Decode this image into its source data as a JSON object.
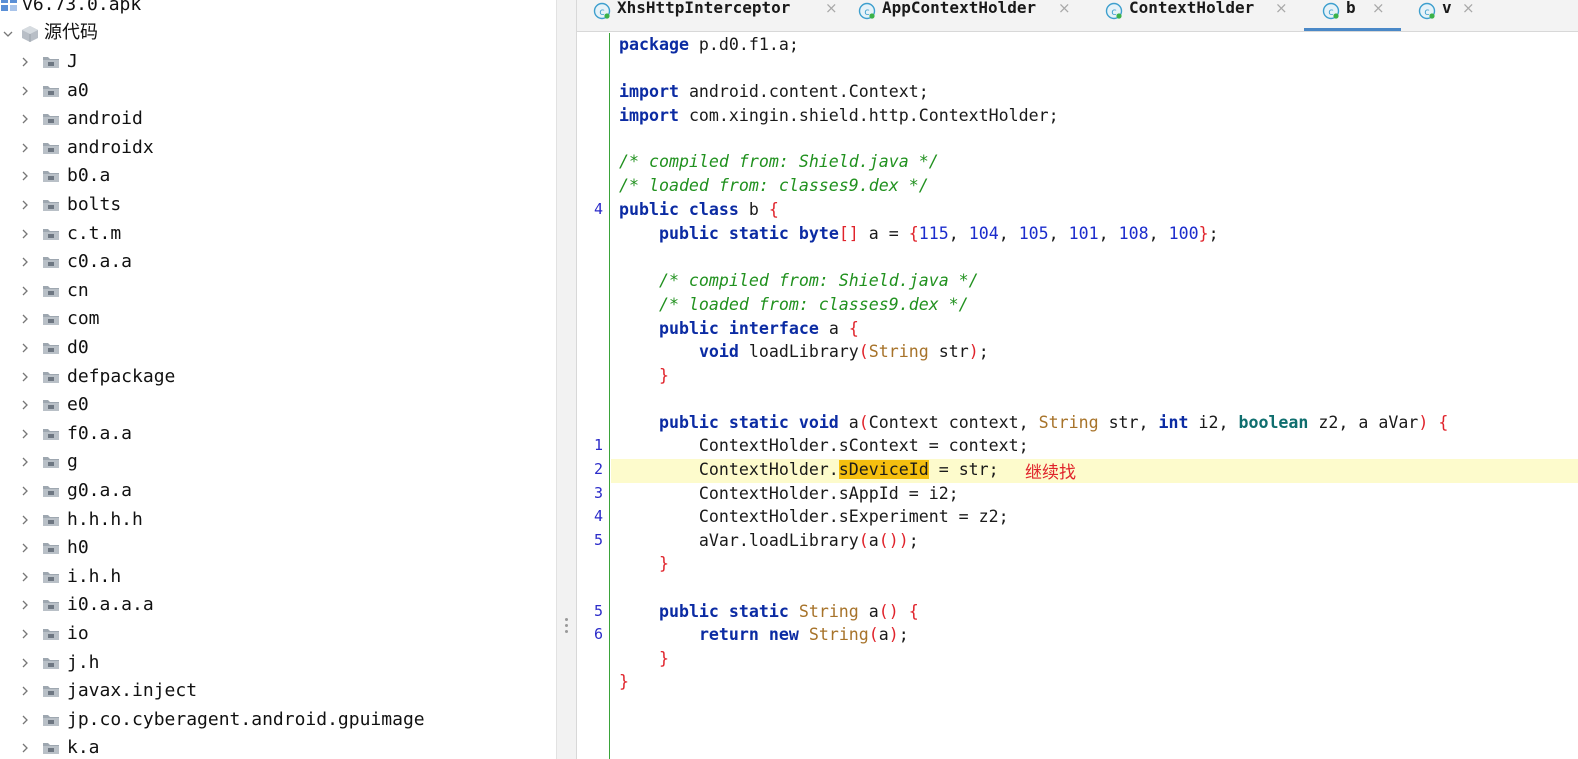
{
  "tree": {
    "root_label": "v6.73.0.apk",
    "source_label": "源代码",
    "items": [
      {
        "label": "J"
      },
      {
        "label": "a0"
      },
      {
        "label": "android"
      },
      {
        "label": "androidx"
      },
      {
        "label": "b0.a"
      },
      {
        "label": "bolts"
      },
      {
        "label": "c.t.m"
      },
      {
        "label": "c0.a.a"
      },
      {
        "label": "cn"
      },
      {
        "label": "com"
      },
      {
        "label": "d0"
      },
      {
        "label": "defpackage"
      },
      {
        "label": "e0"
      },
      {
        "label": "f0.a.a"
      },
      {
        "label": "g"
      },
      {
        "label": "g0.a.a"
      },
      {
        "label": "h.h.h.h"
      },
      {
        "label": "h0"
      },
      {
        "label": "i.h.h"
      },
      {
        "label": "i0.a.a.a"
      },
      {
        "label": "io"
      },
      {
        "label": "j.h"
      },
      {
        "label": "javax.inject"
      },
      {
        "label": "jp.co.cyberagent.android.gpuimage"
      },
      {
        "label": "k.a"
      }
    ]
  },
  "tabs": [
    {
      "label": "XhsHttpInterceptor",
      "active": false
    },
    {
      "label": "AppContextHolder",
      "active": false
    },
    {
      "label": "ContextHolder",
      "active": false
    },
    {
      "label": "b",
      "active": true
    },
    {
      "label": "v",
      "active": false
    }
  ],
  "tab_close_glyph": "×",
  "editor": {
    "gutter_numbers": [
      "4",
      "1",
      "2",
      "3",
      "4",
      "5",
      "5",
      "6"
    ],
    "note": "继续找",
    "highlight_color": "#fdfbcc",
    "line_pkg": [
      "package",
      " p.d0.f1.a;"
    ],
    "line_imp1": [
      "import",
      " android.content.Context;"
    ],
    "line_imp2": [
      "import",
      " com.xingin.shield.http.ContextHolder;"
    ],
    "line_cm1": "/* compiled from: Shield.java */",
    "line_cm2": "/* loaded from: classes9.dex */",
    "line_class": [
      "public class",
      " b ",
      "{"
    ],
    "line_field": [
      "    ",
      "public static",
      " ",
      "byte",
      "[]",
      " a = ",
      "{",
      "115",
      ", ",
      "104",
      ", ",
      "105",
      ", ",
      "101",
      ", ",
      "108",
      ", ",
      "100",
      "}",
      ";"
    ],
    "line_cm3": "    /* compiled from: Shield.java */",
    "line_cm4": "    /* loaded from: classes9.dex */",
    "line_iface": [
      "    ",
      "public interface",
      " a ",
      "{"
    ],
    "line_load": [
      "        ",
      "void",
      " loadLibrary",
      "(",
      "String",
      " str",
      ")",
      ";"
    ],
    "line_close1": [
      "    ",
      "}"
    ],
    "line_method": [
      "    ",
      "public static void",
      " a",
      "(",
      "Context context, ",
      "String",
      " str, ",
      "int",
      " i2, ",
      "boolean",
      " z2, a aVar",
      ")",
      " ",
      "{"
    ],
    "line_s1": "        ContextHolder.sContext = context;",
    "line_s2": [
      "        ContextHolder.",
      "sDeviceId",
      " = str;"
    ],
    "line_s3": "        ContextHolder.sAppId = i2;",
    "line_s4": "        ContextHolder.sExperiment = z2;",
    "line_s5": [
      "        aVar.loadLibrary",
      "(",
      "a",
      "()",
      ")",
      ";"
    ],
    "line_close2": [
      "    ",
      "}"
    ],
    "line_m2": [
      "    ",
      "public static",
      " ",
      "String",
      " a",
      "()",
      " ",
      "{"
    ],
    "line_ret": [
      "        ",
      "return new",
      " ",
      "String",
      "(",
      "a",
      ")",
      ";"
    ],
    "line_close3": [
      "    ",
      "}"
    ],
    "line_close4": "}"
  }
}
